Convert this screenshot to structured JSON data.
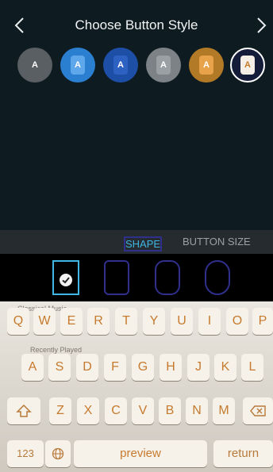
{
  "header": {
    "title": "Choose Button Style",
    "prev_icon": "chevron-left-icon",
    "next_icon": "chevron-right-icon"
  },
  "styles": [
    {
      "label": "A"
    },
    {
      "label": "A"
    },
    {
      "label": "A"
    },
    {
      "label": "A"
    },
    {
      "label": "A"
    },
    {
      "label": "A"
    }
  ],
  "tabs": {
    "shape": "SHAPE",
    "button_size": "BUTTON SIZE"
  },
  "keyboard": {
    "row1": [
      "Q",
      "W",
      "E",
      "R",
      "T",
      "Y",
      "U",
      "I",
      "O",
      "P"
    ],
    "row2": [
      "A",
      "S",
      "D",
      "F",
      "G",
      "H",
      "J",
      "K",
      "L"
    ],
    "row3": [
      "Z",
      "X",
      "C",
      "V",
      "B",
      "N",
      "M"
    ],
    "numbers": "123",
    "space": "preview",
    "return": "return",
    "background_text": [
      "Classical Music",
      "Recently Played"
    ]
  },
  "colors": {
    "accent": "#3fb6e3",
    "background": "#0f1d22",
    "key_text": "#c67a2d"
  }
}
